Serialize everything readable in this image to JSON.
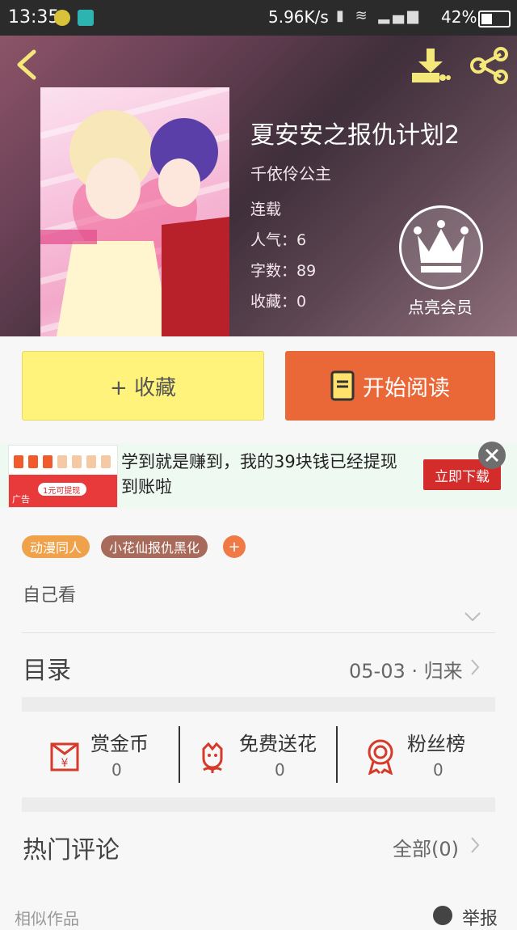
{
  "status_bar": {
    "time": "13:35",
    "net_speed": "5.96K/s",
    "battery": "42%"
  },
  "book": {
    "title": "夏安安之报仇计划2",
    "author": "千依伶公主",
    "status": "连载",
    "popularity": "人气：6",
    "word_count": "字数：89",
    "favorites": "收藏：0",
    "vip_label": "点亮会员"
  },
  "actions": {
    "favorite": "+ 收藏",
    "read": "开始阅读"
  },
  "ad": {
    "text": "学到就是赚到，我的39块钱已经提现到账啦",
    "button": "立即下载",
    "badge": "广告",
    "thumb_caption": "1元可提现"
  },
  "tags": [
    "动漫同人",
    "小花仙报仇黑化"
  ],
  "tag_add": "+",
  "description": "自己看",
  "catalog": {
    "title": "目录",
    "latest": "05-03 · 归来"
  },
  "stats": [
    {
      "label": "赏金币",
      "value": "0",
      "icon": "red-envelope-icon"
    },
    {
      "label": "免费送花",
      "value": "0",
      "icon": "flower-icon"
    },
    {
      "label": "粉丝榜",
      "value": "0",
      "icon": "medal-icon"
    }
  ],
  "comments": {
    "title": "热门评论",
    "all": "全部(0)"
  },
  "similar": {
    "title": "相似作品",
    "report": "举报"
  },
  "colors": {
    "accent_orange": "#ea6838",
    "fav_yellow": "#fff37b",
    "tag_orange": "#f0a24a",
    "tag_brown": "#a86a5a",
    "icon_red": "#d53a2a"
  }
}
